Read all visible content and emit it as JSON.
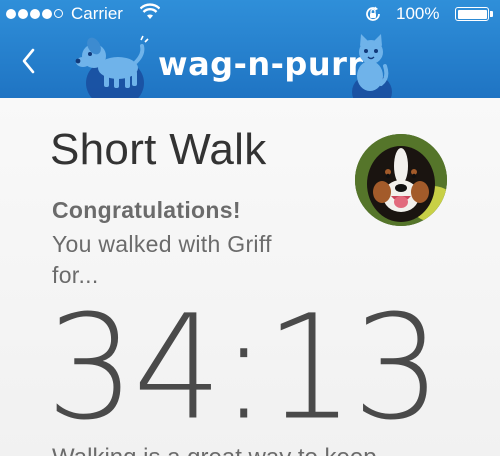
{
  "status_bar": {
    "carrier": "Carrier",
    "battery_percent": "100%",
    "battery_level": 1.0,
    "signal_icon": "signal-dots-icon",
    "wifi_icon": "wifi-icon",
    "rotation_lock_icon": "rotation-lock-icon"
  },
  "header": {
    "logo_text": "wag-n-purr",
    "back_icon": "chevron-left-icon",
    "brand_color": "#1f74c3"
  },
  "walk": {
    "title": "Short Walk",
    "congrats": "Congratulations!",
    "message": "You walked with Griff for...",
    "duration": "34:13",
    "pet_name": "Griff"
  },
  "footer": {
    "cutoff_text": "Walking is a great way to keep"
  }
}
